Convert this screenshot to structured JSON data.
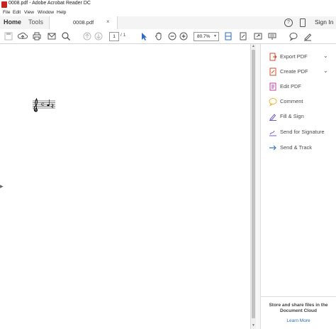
{
  "window": {
    "title": "0008.pdf - Adobe Acrobat Reader DC"
  },
  "menu": [
    "File",
    "Edit",
    "View",
    "Window",
    "Help"
  ],
  "nav": {
    "home": "Home",
    "tools": "Tools",
    "doc_tab": "0008.pdf",
    "close_tab": "×",
    "sign_in": "Sign In",
    "help": "?"
  },
  "toolbar": {
    "page_current": "1",
    "page_total": "/ 1",
    "zoom": "80.7%"
  },
  "right_pane": {
    "tools": [
      {
        "label": "Export PDF",
        "icon": "export-pdf-icon",
        "color": "#d64c2b",
        "expandable": true
      },
      {
        "label": "Create PDF",
        "icon": "create-pdf-icon",
        "color": "#d64c2b",
        "expandable": true
      },
      {
        "label": "Edit PDF",
        "icon": "edit-pdf-icon",
        "color": "#c03fa5",
        "expandable": false
      },
      {
        "label": "Comment",
        "icon": "comment-icon",
        "color": "#f2b632",
        "expandable": false
      },
      {
        "label": "Fill & Sign",
        "icon": "fill-sign-icon",
        "color": "#6a5fc9",
        "expandable": false
      },
      {
        "label": "Send for Signature",
        "icon": "send-signature-icon",
        "color": "#6a5fc9",
        "expandable": false
      },
      {
        "label": "Send & Track",
        "icon": "send-track-icon",
        "color": "#3b78c4",
        "expandable": false
      }
    ],
    "cloud_text": "Store and share files in the Document Cloud",
    "learn_more": "Learn More"
  }
}
